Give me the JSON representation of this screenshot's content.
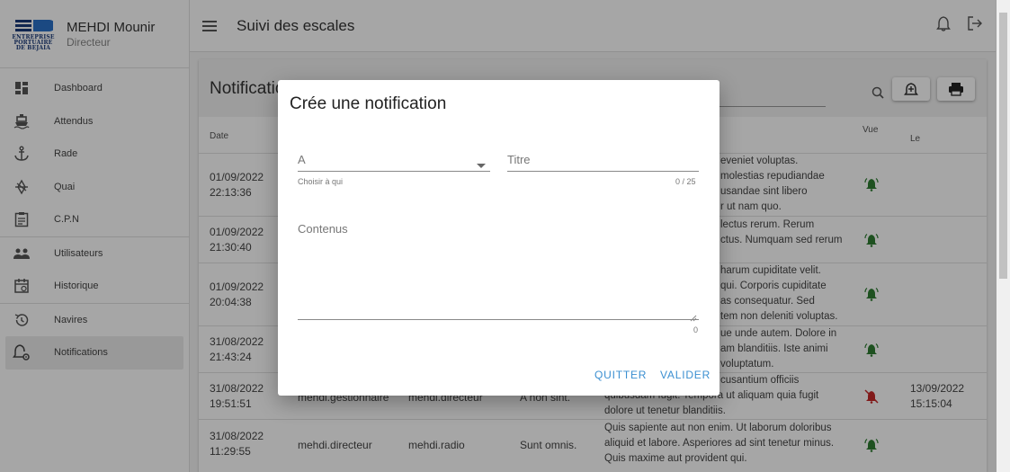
{
  "profile": {
    "name": "MEHDI Mounir",
    "role": "Directeur",
    "logo_lines": [
      "ENTREPRISE",
      "PORTUAIRE",
      "DE BEJAIA"
    ]
  },
  "sidebar": {
    "items": [
      {
        "label": "Dashboard",
        "icon": "dashboard-icon"
      },
      {
        "label": "Attendus",
        "icon": "ship-icon"
      },
      {
        "label": "Rade",
        "icon": "anchor-icon"
      },
      {
        "label": "Quai",
        "icon": "dock-icon"
      },
      {
        "label": "C.P.N",
        "icon": "clipboard-icon"
      },
      {
        "label": "Utilisateurs",
        "icon": "users-icon"
      },
      {
        "label": "Historique",
        "icon": "calendar-icon"
      },
      {
        "label": "Navires",
        "icon": "history-icon"
      },
      {
        "label": "Notifications",
        "icon": "bell-settings-icon",
        "active": true
      }
    ]
  },
  "topbar": {
    "title": "Suivi des escales"
  },
  "card": {
    "title": "Notificatio",
    "headers": {
      "date": "Date",
      "vue": "Vue",
      "le": "Le"
    },
    "rows": [
      {
        "date": "01/09/2022",
        "time": "22:13:36",
        "msg": [
          "eveniet voluptas.",
          "molestias repudiandae",
          "usandae sint libero",
          "r ut nam quo."
        ],
        "seen": true,
        "le_date": "",
        "le_time": ""
      },
      {
        "date": "01/09/2022",
        "time": "21:30:40",
        "msg": [
          "lectus rerum. Rerum",
          "ctus. Numquam sed rerum"
        ],
        "seen": true,
        "le_date": "",
        "le_time": ""
      },
      {
        "date": "01/09/2022",
        "time": "20:04:38",
        "msg": [
          "harum cupiditate velit.",
          "qui. Corporis cupiditate",
          "as consequatur. Sed",
          "tem non deleniti voluptas."
        ],
        "seen": true,
        "le_date": "",
        "le_time": ""
      },
      {
        "date": "31/08/2022",
        "time": "21:43:24",
        "msg": [
          "ue unde autem. Dolore in",
          "am blanditiis. Iste animi",
          "voluptatum."
        ],
        "seen": true,
        "le_date": "",
        "le_time": ""
      },
      {
        "date": "31/08/2022",
        "time": "19:51:51",
        "from": "mehdi.gestionnaire",
        "to": "mehdi.directeur",
        "subject": "A non sint.",
        "msg": [
          "cusantium officiis",
          "quibusdam fugit. Tempora ut aliquam quia fugit",
          "dolore ut tenetur blanditiis."
        ],
        "seen": false,
        "le_date": "13/09/2022",
        "le_time": "15:15:04"
      },
      {
        "date": "31/08/2022",
        "time": "11:29:55",
        "from": "mehdi.directeur",
        "to": "mehdi.radio",
        "subject": "Sunt omnis.",
        "msg": [
          "Quis sapiente aut non enim. Ut laborum doloribus",
          "aliquid et labore. Asperiores ad sint tenetur minus.",
          "Quis maxime aut provident qui."
        ],
        "seen": true,
        "le_date": "",
        "le_time": ""
      }
    ]
  },
  "dialog": {
    "title": "Crée une notification",
    "to_label": "A",
    "to_hint": "Choisir à qui",
    "title_label": "Titre",
    "title_counter": "0 / 25",
    "content_label": "Contenus",
    "content_counter": "0",
    "cancel_label": "QUITTER",
    "submit_label": "VALIDER"
  },
  "colors": {
    "accent": "#3b8fd1",
    "seen": "#2e7d32",
    "unseen": "#c62828"
  }
}
